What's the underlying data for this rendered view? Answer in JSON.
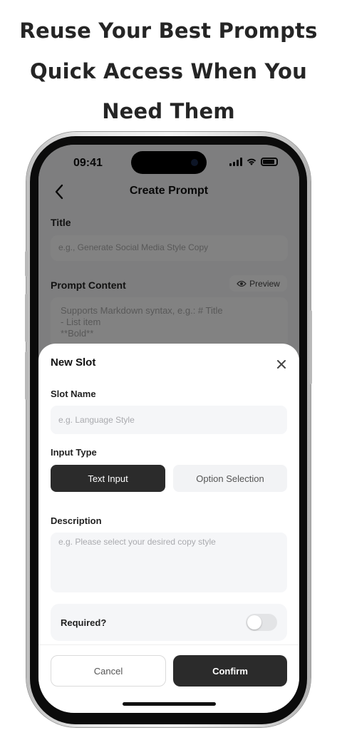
{
  "headline": {
    "line1": "Reuse Your Best Prompts",
    "line2": "Quick Access When You",
    "line3": "Need Them"
  },
  "status_bar": {
    "time": "09:41"
  },
  "nav": {
    "title": "Create Prompt",
    "back_icon": "chevron-left-icon"
  },
  "background_form": {
    "title_label": "Title",
    "title_placeholder": "e.g., Generate Social Media Style Copy",
    "content_label": "Prompt Content",
    "preview_label": "Preview",
    "content_placeholder_lines": [
      "Supports Markdown syntax, e.g.: # Title",
      "- List item",
      "**Bold**"
    ]
  },
  "sheet": {
    "title": "New Slot",
    "close_icon": "close-icon",
    "slot_name_label": "Slot Name",
    "slot_name_placeholder": "e.g. Language Style",
    "input_type_label": "Input Type",
    "input_type_options": [
      "Text Input",
      "Option Selection"
    ],
    "input_type_selected": "Text Input",
    "description_label": "Description",
    "description_placeholder": "e.g. Please select your desired copy style",
    "required_label": "Required?",
    "required_on": false,
    "cancel_label": "Cancel",
    "confirm_label": "Confirm"
  },
  "colors": {
    "primary_dark": "#2b2b2b",
    "overlay": "rgba(0,0,0,0.48)"
  }
}
